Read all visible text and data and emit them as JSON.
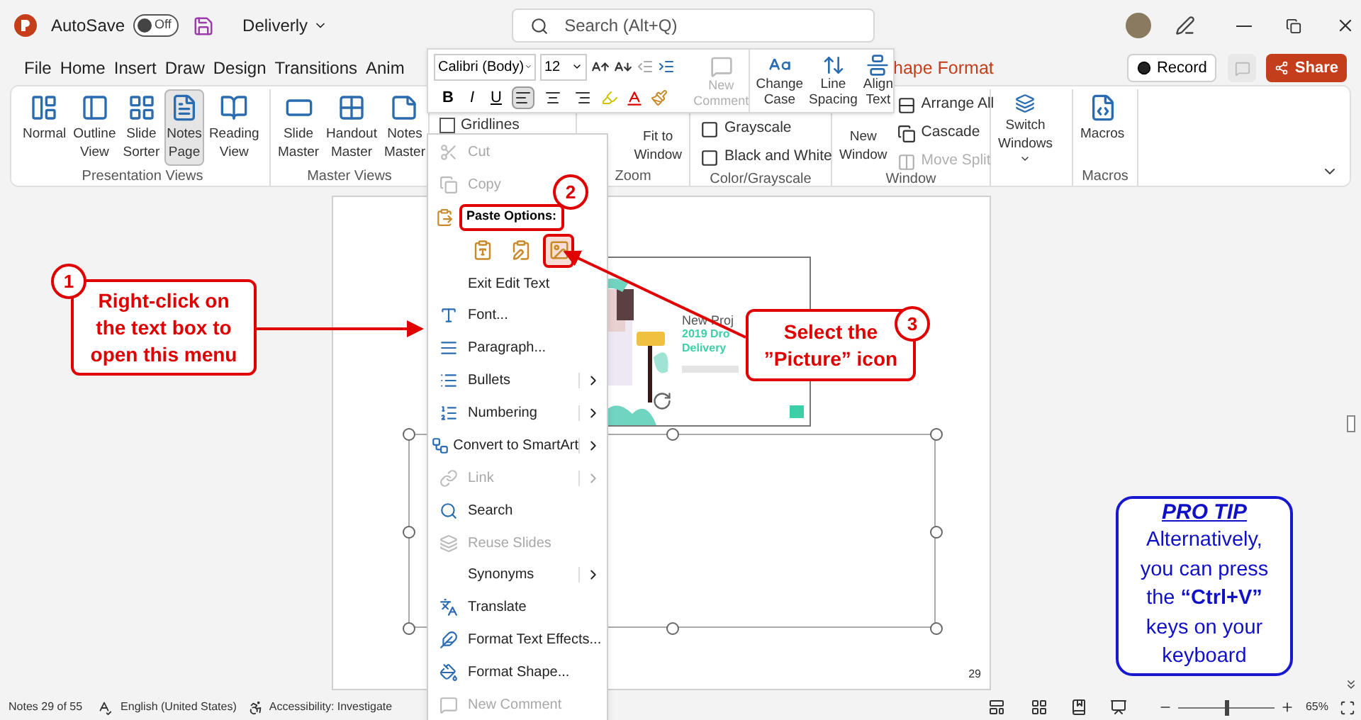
{
  "title_bar": {
    "autosave_label": "AutoSave",
    "autosave": {
      "on": false,
      "label": "Off"
    },
    "document": "Deliverly",
    "search": {
      "placeholder": "Search (Alt+Q)"
    }
  },
  "tabs": [
    {
      "label": "File",
      "selected": false
    },
    {
      "label": "Home",
      "selected": false
    },
    {
      "label": "Insert",
      "selected": false
    },
    {
      "label": "Draw",
      "selected": false
    },
    {
      "label": "Design",
      "selected": false
    },
    {
      "label": "Transitions",
      "selected": false
    },
    {
      "label": "Anim",
      "selected": false
    }
  ],
  "contextual_tab": "hape Format",
  "record_button": "Record",
  "share_button": "Share",
  "ribbon": {
    "groups": [
      {
        "label": "Presentation Views",
        "items": [
          {
            "kind": "large",
            "label": "Normal",
            "selected": false
          },
          {
            "kind": "large",
            "label": "Outline View",
            "selected": false
          },
          {
            "kind": "large",
            "label": "Slide Sorter",
            "selected": false
          },
          {
            "kind": "large",
            "label": "Notes Page",
            "selected": true
          },
          {
            "kind": "large",
            "label": "Reading View",
            "selected": false
          }
        ]
      },
      {
        "label": "Master Views",
        "items": [
          {
            "kind": "large",
            "label": "Slide Master"
          },
          {
            "kind": "large",
            "label": "Handout Master"
          },
          {
            "kind": "large",
            "label": "Notes Master"
          }
        ]
      },
      {
        "items": [
          {
            "kind": "checkbox",
            "label": "Gridlines",
            "checked": false
          }
        ]
      },
      {
        "label": "Zoom",
        "items": [
          {
            "kind": "large",
            "label": "Fit to Window"
          }
        ]
      },
      {
        "label": "Color/Grayscale",
        "items": [
          {
            "kind": "small",
            "label": "Grayscale",
            "disabled": false
          },
          {
            "kind": "small",
            "label": "Black and White",
            "disabled": false
          }
        ]
      },
      {
        "label": "Window",
        "items": [
          {
            "kind": "large",
            "label": "New Window"
          },
          {
            "kind": "small",
            "label": "Arrange All",
            "disabled": false
          },
          {
            "kind": "small",
            "label": "Cascade",
            "disabled": false
          },
          {
            "kind": "small",
            "label": "Move Split",
            "disabled": true
          }
        ]
      },
      {
        "items": [
          {
            "kind": "large",
            "label": "Switch Windows",
            "dropdown": true
          }
        ]
      },
      {
        "label": "Macros",
        "items": [
          {
            "kind": "large",
            "label": "Macros"
          }
        ]
      }
    ]
  },
  "mini_toolbar": {
    "font": "Calibri (Body)",
    "size": "12",
    "new_comment": {
      "label": "New Comment",
      "disabled": true
    },
    "tools": [
      "Change Case",
      "Line Spacing",
      "Align Text"
    ],
    "styles": [
      "B",
      "I",
      "U"
    ],
    "alignment": [
      {
        "selected": true
      },
      {
        "selected": false
      },
      {
        "selected": false
      }
    ]
  },
  "context_menu": {
    "items": [
      {
        "kind": "item",
        "label": "Cut",
        "disabled": true,
        "submenu": false
      },
      {
        "kind": "item",
        "label": "Copy",
        "disabled": true,
        "submenu": false
      },
      {
        "kind": "header",
        "label": "Paste Options:"
      },
      {
        "kind": "paste",
        "options": [
          {
            "selected": false
          },
          {
            "selected": false
          },
          {
            "selected": true
          }
        ]
      },
      {
        "kind": "item",
        "label": "Exit Edit Text",
        "disabled": false,
        "submenu": false
      },
      {
        "kind": "item",
        "label": "Font...",
        "disabled": false,
        "submenu": false
      },
      {
        "kind": "item",
        "label": "Paragraph...",
        "disabled": false,
        "submenu": false
      },
      {
        "kind": "item",
        "label": "Bullets",
        "disabled": false,
        "submenu": true
      },
      {
        "kind": "item",
        "label": "Numbering",
        "disabled": false,
        "submenu": true
      },
      {
        "kind": "item",
        "label": "Convert to SmartArt",
        "disabled": false,
        "submenu": true
      },
      {
        "kind": "item",
        "label": "Link",
        "disabled": true,
        "submenu": true
      },
      {
        "kind": "item",
        "label": "Search",
        "disabled": false,
        "submenu": false
      },
      {
        "kind": "item",
        "label": "Reuse Slides",
        "disabled": true,
        "submenu": false
      },
      {
        "kind": "item",
        "label": "Synonyms",
        "disabled": false,
        "submenu": true
      },
      {
        "kind": "item",
        "label": "Translate",
        "disabled": false,
        "submenu": false
      },
      {
        "kind": "item",
        "label": "Format Text Effects...",
        "disabled": false,
        "submenu": false
      },
      {
        "kind": "item",
        "label": "Format Shape...",
        "disabled": false,
        "submenu": false
      },
      {
        "kind": "item",
        "label": "New Comment",
        "disabled": true,
        "submenu": false
      }
    ]
  },
  "slide": {
    "title": "New Proj",
    "heading_lines": [
      "2019 Dro",
      "Delivery"
    ]
  },
  "page_number": "29",
  "callouts": [
    {
      "number": "1",
      "text": "Right-click on the text box to open this menu"
    },
    {
      "number": "2"
    },
    {
      "number": "3",
      "text": "Select the ”Picture” icon"
    }
  ],
  "pro_tip": {
    "title": "PRO TIP",
    "text": "Alternatively, you can press the **“Ctrl+V”** keys on your keyboard"
  },
  "status_bar": {
    "notes": "Notes 29 of 55",
    "language": "English (United States)",
    "accessibility": "Accessibility: Investigate",
    "zoom": {
      "level": 0.5,
      "label": "65%"
    }
  }
}
